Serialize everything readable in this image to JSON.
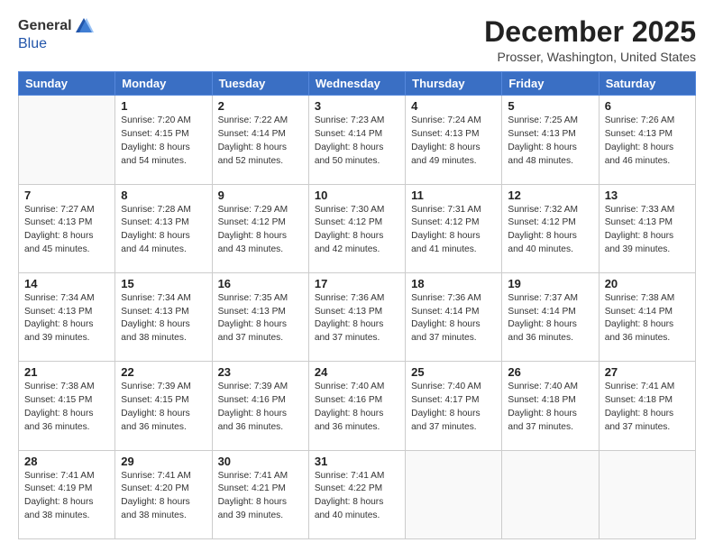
{
  "logo": {
    "general": "General",
    "blue": "Blue"
  },
  "header": {
    "month": "December 2025",
    "location": "Prosser, Washington, United States"
  },
  "days_of_week": [
    "Sunday",
    "Monday",
    "Tuesday",
    "Wednesday",
    "Thursday",
    "Friday",
    "Saturday"
  ],
  "weeks": [
    [
      {
        "day": "",
        "info": ""
      },
      {
        "day": "1",
        "info": "Sunrise: 7:20 AM\nSunset: 4:15 PM\nDaylight: 8 hours\nand 54 minutes."
      },
      {
        "day": "2",
        "info": "Sunrise: 7:22 AM\nSunset: 4:14 PM\nDaylight: 8 hours\nand 52 minutes."
      },
      {
        "day": "3",
        "info": "Sunrise: 7:23 AM\nSunset: 4:14 PM\nDaylight: 8 hours\nand 50 minutes."
      },
      {
        "day": "4",
        "info": "Sunrise: 7:24 AM\nSunset: 4:13 PM\nDaylight: 8 hours\nand 49 minutes."
      },
      {
        "day": "5",
        "info": "Sunrise: 7:25 AM\nSunset: 4:13 PM\nDaylight: 8 hours\nand 48 minutes."
      },
      {
        "day": "6",
        "info": "Sunrise: 7:26 AM\nSunset: 4:13 PM\nDaylight: 8 hours\nand 46 minutes."
      }
    ],
    [
      {
        "day": "7",
        "info": "Sunrise: 7:27 AM\nSunset: 4:13 PM\nDaylight: 8 hours\nand 45 minutes."
      },
      {
        "day": "8",
        "info": "Sunrise: 7:28 AM\nSunset: 4:13 PM\nDaylight: 8 hours\nand 44 minutes."
      },
      {
        "day": "9",
        "info": "Sunrise: 7:29 AM\nSunset: 4:12 PM\nDaylight: 8 hours\nand 43 minutes."
      },
      {
        "day": "10",
        "info": "Sunrise: 7:30 AM\nSunset: 4:12 PM\nDaylight: 8 hours\nand 42 minutes."
      },
      {
        "day": "11",
        "info": "Sunrise: 7:31 AM\nSunset: 4:12 PM\nDaylight: 8 hours\nand 41 minutes."
      },
      {
        "day": "12",
        "info": "Sunrise: 7:32 AM\nSunset: 4:12 PM\nDaylight: 8 hours\nand 40 minutes."
      },
      {
        "day": "13",
        "info": "Sunrise: 7:33 AM\nSunset: 4:13 PM\nDaylight: 8 hours\nand 39 minutes."
      }
    ],
    [
      {
        "day": "14",
        "info": "Sunrise: 7:34 AM\nSunset: 4:13 PM\nDaylight: 8 hours\nand 39 minutes."
      },
      {
        "day": "15",
        "info": "Sunrise: 7:34 AM\nSunset: 4:13 PM\nDaylight: 8 hours\nand 38 minutes."
      },
      {
        "day": "16",
        "info": "Sunrise: 7:35 AM\nSunset: 4:13 PM\nDaylight: 8 hours\nand 37 minutes."
      },
      {
        "day": "17",
        "info": "Sunrise: 7:36 AM\nSunset: 4:13 PM\nDaylight: 8 hours\nand 37 minutes."
      },
      {
        "day": "18",
        "info": "Sunrise: 7:36 AM\nSunset: 4:14 PM\nDaylight: 8 hours\nand 37 minutes."
      },
      {
        "day": "19",
        "info": "Sunrise: 7:37 AM\nSunset: 4:14 PM\nDaylight: 8 hours\nand 36 minutes."
      },
      {
        "day": "20",
        "info": "Sunrise: 7:38 AM\nSunset: 4:14 PM\nDaylight: 8 hours\nand 36 minutes."
      }
    ],
    [
      {
        "day": "21",
        "info": "Sunrise: 7:38 AM\nSunset: 4:15 PM\nDaylight: 8 hours\nand 36 minutes."
      },
      {
        "day": "22",
        "info": "Sunrise: 7:39 AM\nSunset: 4:15 PM\nDaylight: 8 hours\nand 36 minutes."
      },
      {
        "day": "23",
        "info": "Sunrise: 7:39 AM\nSunset: 4:16 PM\nDaylight: 8 hours\nand 36 minutes."
      },
      {
        "day": "24",
        "info": "Sunrise: 7:40 AM\nSunset: 4:16 PM\nDaylight: 8 hours\nand 36 minutes."
      },
      {
        "day": "25",
        "info": "Sunrise: 7:40 AM\nSunset: 4:17 PM\nDaylight: 8 hours\nand 37 minutes."
      },
      {
        "day": "26",
        "info": "Sunrise: 7:40 AM\nSunset: 4:18 PM\nDaylight: 8 hours\nand 37 minutes."
      },
      {
        "day": "27",
        "info": "Sunrise: 7:41 AM\nSunset: 4:18 PM\nDaylight: 8 hours\nand 37 minutes."
      }
    ],
    [
      {
        "day": "28",
        "info": "Sunrise: 7:41 AM\nSunset: 4:19 PM\nDaylight: 8 hours\nand 38 minutes."
      },
      {
        "day": "29",
        "info": "Sunrise: 7:41 AM\nSunset: 4:20 PM\nDaylight: 8 hours\nand 38 minutes."
      },
      {
        "day": "30",
        "info": "Sunrise: 7:41 AM\nSunset: 4:21 PM\nDaylight: 8 hours\nand 39 minutes."
      },
      {
        "day": "31",
        "info": "Sunrise: 7:41 AM\nSunset: 4:22 PM\nDaylight: 8 hours\nand 40 minutes."
      },
      {
        "day": "",
        "info": ""
      },
      {
        "day": "",
        "info": ""
      },
      {
        "day": "",
        "info": ""
      }
    ]
  ]
}
